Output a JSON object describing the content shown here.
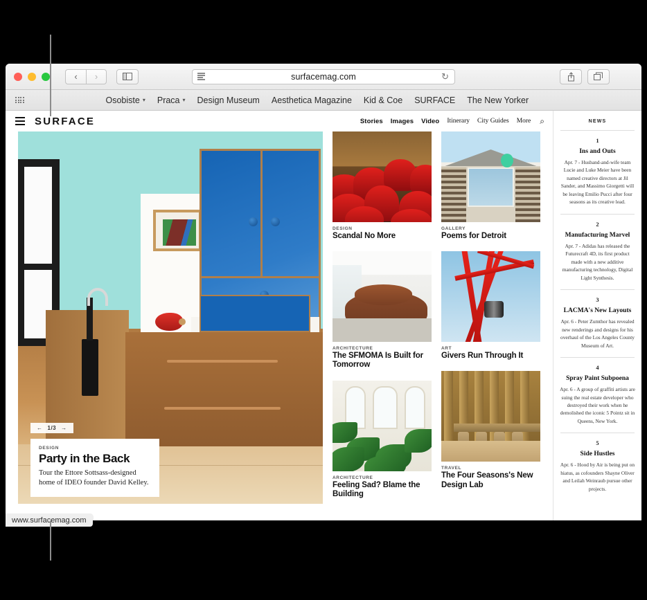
{
  "browser": {
    "url_display": "surfacemag.com",
    "back_icon": "‹",
    "forward_icon": "›",
    "reload_icon": "↻",
    "new_tab_icon": "+",
    "favorites": [
      {
        "label": "Osobiste",
        "has_caret": true
      },
      {
        "label": "Praca",
        "has_caret": true
      },
      {
        "label": "Design Museum",
        "has_caret": false
      },
      {
        "label": "Aesthetica Magazine",
        "has_caret": false
      },
      {
        "label": "Kid & Coe",
        "has_caret": false
      },
      {
        "label": "SURFACE",
        "has_caret": false
      },
      {
        "label": "The New Yorker",
        "has_caret": false
      }
    ],
    "status_url": "www.surfacemag.com"
  },
  "site": {
    "brand": "SURFACE",
    "nav_bold": [
      "Stories",
      "Images",
      "Video"
    ],
    "nav_serif": [
      "Itinerary",
      "City Guides",
      "More"
    ],
    "search_icon": "⌕"
  },
  "hero": {
    "pager_prev": "←",
    "pager_text": "1/3",
    "pager_next": "→",
    "kicker": "DESIGN",
    "title": "Party in the Back",
    "subtitle": "Tour the Ettore Sottsass-designed home of IDEO founder David Kelley."
  },
  "cards": [
    {
      "kicker": "DESIGN",
      "headline": "Scandal No More"
    },
    {
      "kicker": "GALLERY",
      "headline": "Poems for Detroit"
    },
    {
      "kicker": "ARCHITECTURE",
      "headline": "The SFMOMA Is Built for Tomorrow"
    },
    {
      "kicker": "ART",
      "headline": "Givers Run Through It"
    },
    {
      "kicker": "ARCHITECTURE",
      "headline": "Feeling Sad? Blame the Building"
    },
    {
      "kicker": "TRAVEL",
      "headline": "The Four Seasons's New Design Lab"
    }
  ],
  "news": {
    "label": "NEWS",
    "items": [
      {
        "num": "1",
        "title": "Ins and Outs",
        "body": "Apr. 7 - Husband-and-wife team Lucie and Luke Meier have been named creative directors at Jil Sander, and Massimo Giorgetti will be leaving Emilio Pucci after four seasons as its creative lead."
      },
      {
        "num": "2",
        "title": "Manufacturing Marvel",
        "body": "Apr. 7 - Adidas has released the Futurecraft 4D, its first product made with a new additive manufacturing technology, Digital Light Synthesis."
      },
      {
        "num": "3",
        "title": "LACMA's New Layouts",
        "body": "Apr. 6 - Peter Zumthor has revealed new renderings and designs for his overhaul of the Los Angeles County Museum of Art."
      },
      {
        "num": "4",
        "title": "Spray Paint Subpoena",
        "body": "Apr. 6 - A group of graffiti artists are suing the real estate developer who destroyed their work when he demolished the iconic 5 Pointz sit in Queens, New York."
      },
      {
        "num": "5",
        "title": "Side Hustles",
        "body": "Apr. 6 - Hood by Air is being put on hiatus, as cofounders Shayne Oliver and Leilah Weinraub pursue other projects."
      }
    ]
  },
  "colors": {
    "hero_wall": "#9fe0db",
    "hero_cabinet": "#1664b4",
    "accent_red": "#e0201c"
  }
}
